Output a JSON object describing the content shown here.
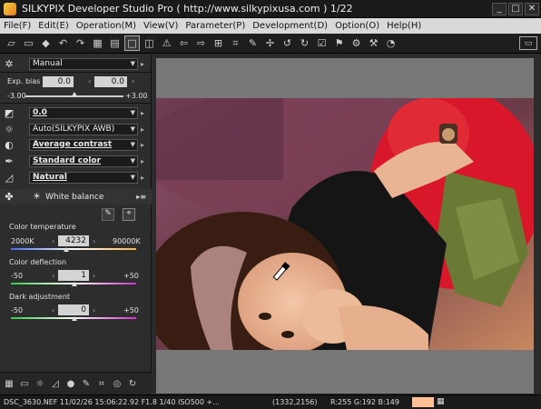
{
  "window": {
    "title": "SILKYPIX Developer Studio Pro ( http://www.silkypixusa.com )   1/22",
    "buttons": [
      "_",
      "□",
      "✕"
    ]
  },
  "menu": [
    "File(F)",
    "Edit(E)",
    "Operation(M)",
    "View(V)",
    "Parameter(P)",
    "Development(D)",
    "Option(O)",
    "Help(H)"
  ],
  "panel": {
    "preset": "Manual",
    "exp_bias_label": "Exp. bias",
    "exp_bias_value": "0.0",
    "exp_bias_fine": "0.0",
    "exp_bias_min": "-3.00",
    "exp_bias_max": "+3.00",
    "tone_value": "0.0",
    "wb_mode": "Auto(SILKYPIX AWB)",
    "contrast": "Average contrast",
    "color": "Standard color",
    "sharpness": "Natural",
    "wb_title": "White balance",
    "color_temp_label": "Color temperature",
    "color_temp_min": "2000K",
    "color_temp_value": "4232",
    "color_temp_max": "90000K",
    "color_defl_label": "Color deflection",
    "color_defl_min": "-50",
    "color_defl_value": "1",
    "color_defl_max": "+50",
    "dark_adj_label": "Dark adjustment",
    "dark_adj_min": "-50",
    "dark_adj_value": "0",
    "dark_adj_max": "+50"
  },
  "status": {
    "file_info": "DSC_3630.NEF 11/02/26 15:06:22.92 F1.8 1/40 ISO500 +...",
    "coords": "(1332,2156)",
    "rgb": "R:255 G:192 B:149",
    "swatch_color": "#ffc095"
  }
}
